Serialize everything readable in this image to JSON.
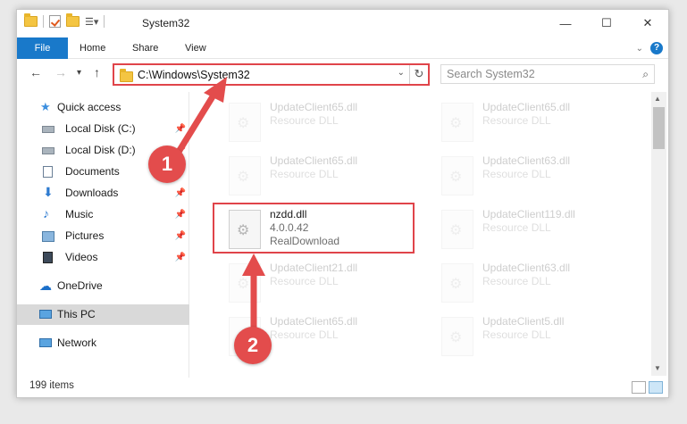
{
  "window": {
    "title": "System32",
    "caption_minimize": "—",
    "caption_maximize": "☐",
    "caption_close": "✕"
  },
  "ribbon": {
    "tabs": [
      {
        "label": "File"
      },
      {
        "label": "Home"
      },
      {
        "label": "Share"
      },
      {
        "label": "View"
      }
    ],
    "help": "?"
  },
  "navbar": {
    "back_icon": "←",
    "forward_icon": "→",
    "recent_icon": "▾",
    "up_icon": "↑",
    "address": "C:\\Windows\\System32",
    "search_placeholder": "Search System32",
    "search_icon": "⌕"
  },
  "nav_pane": {
    "items": [
      {
        "label": "Quick access",
        "icon": "star-icon",
        "color": "#3c8fdf"
      },
      {
        "label": "Local Disk (C:)",
        "icon": "drive-icon",
        "pinned": true
      },
      {
        "label": "Local Disk (D:)",
        "icon": "drive-icon",
        "pinned": true
      },
      {
        "label": "Documents",
        "icon": "documents-icon",
        "pinned": true
      },
      {
        "label": "Downloads",
        "icon": "downloads-icon",
        "pinned": true
      },
      {
        "label": "Music",
        "icon": "music-icon",
        "pinned": true
      },
      {
        "label": "Pictures",
        "icon": "pictures-icon",
        "pinned": true
      },
      {
        "label": "Videos",
        "icon": "videos-icon",
        "pinned": true
      },
      {
        "label": "OneDrive",
        "icon": "cloud-icon"
      },
      {
        "label": "This PC",
        "icon": "computer-icon",
        "selected": true
      },
      {
        "label": "Network",
        "icon": "network-icon"
      }
    ]
  },
  "files": [
    {
      "name": "UpdateClient65.dll",
      "type": "Resource DLL",
      "faded": true
    },
    {
      "name": "UpdateClient65.dll",
      "type": "Resource DLL",
      "faded": true
    },
    {
      "name": "UpdateClient65.dll",
      "type": "Resource DLL",
      "faded": true
    },
    {
      "name": "UpdateClient63.dll",
      "type": "Resource DLL",
      "faded": true
    },
    {
      "name": "nzdd.dll",
      "type": "4.0.0.42",
      "company": "RealDownload",
      "faded": false
    },
    {
      "name": "UpdateClient119.dll",
      "type": "Resource DLL",
      "faded": true
    },
    {
      "name": "UpdateClient21.dll",
      "type": "Resource DLL",
      "faded": true
    },
    {
      "name": "UpdateClient63.dll",
      "type": "Resource DLL",
      "faded": true
    },
    {
      "name": "UpdateClient65.dll",
      "type": "Resource DLL",
      "faded": true
    },
    {
      "name": "UpdateClient5.dll",
      "type": "Resource DLL",
      "faded": true
    }
  ],
  "status": {
    "count": "199 items"
  },
  "annotations": {
    "badge1": "1",
    "badge2": "2",
    "accent": "#e0444a"
  }
}
